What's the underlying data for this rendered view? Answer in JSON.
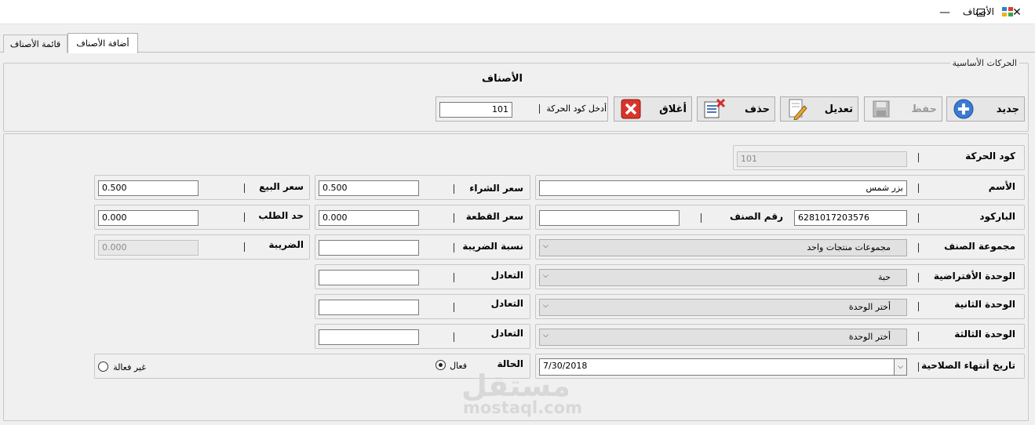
{
  "window": {
    "title": "الأصناف",
    "icons": {
      "app": "app-grid-icon",
      "min": "minimize-icon",
      "max": "maximize-icon",
      "close": "close-icon"
    }
  },
  "tabs": [
    {
      "label": "قائمة الأصناف"
    },
    {
      "label": "أضافة الأصناف",
      "active": true
    }
  ],
  "toolbar": {
    "group_title": "الحركات الأساسية",
    "form_title": "الأصناف",
    "new_label": "جديد",
    "save_label": "حفظ",
    "edit_label": "تعديل",
    "delete_label": "حذف",
    "close_label": "أغلاق",
    "code_label": "أدخل كود الحركة",
    "code_value": "101"
  },
  "form": {
    "move_code": {
      "label": "كود الحركة",
      "value": "101"
    },
    "name": {
      "label": "الأسم",
      "value": "بزر شمس"
    },
    "barcode": {
      "label": "الباركود",
      "value": "6281017203576"
    },
    "item_no": {
      "label": "رقم الصنف",
      "value": ""
    },
    "group": {
      "label": "مجموعة الصنف",
      "value": "مجموعات منتجات واحد"
    },
    "unit_default": {
      "label": "الوحدة الأفتراضية",
      "value": "حبة"
    },
    "unit_second": {
      "label": "الوحدة الثانية",
      "value": "أختر الوحدة"
    },
    "unit_third": {
      "label": "الوحدة الثالثة",
      "value": "أختر الوحدة"
    },
    "expiry": {
      "label": "تاريخ أنتهاء الصلاحية",
      "value": "7/30/2018"
    },
    "purchase_price": {
      "label": "سعر الشراء",
      "value": "0.500"
    },
    "piece_price": {
      "label": "سعر القطعة",
      "value": "0.000"
    },
    "tax_rate": {
      "label": "نسبة الضريبة",
      "value": ""
    },
    "equiv_label": "التعادل",
    "equiv1": "",
    "equiv2": "",
    "equiv3": "",
    "status": {
      "label": "الحالة",
      "active": "فعال",
      "inactive": "غير فعالة",
      "selected": "active"
    },
    "sale_price": {
      "label": "سعر البيع",
      "value": "0.500"
    },
    "reorder": {
      "label": "حد الطلب",
      "value": "0.000"
    },
    "tax": {
      "label": "الضريبة",
      "value": "0.000"
    }
  },
  "watermark": {
    "arabic": "مستقل",
    "latin": "mostaql.com"
  }
}
